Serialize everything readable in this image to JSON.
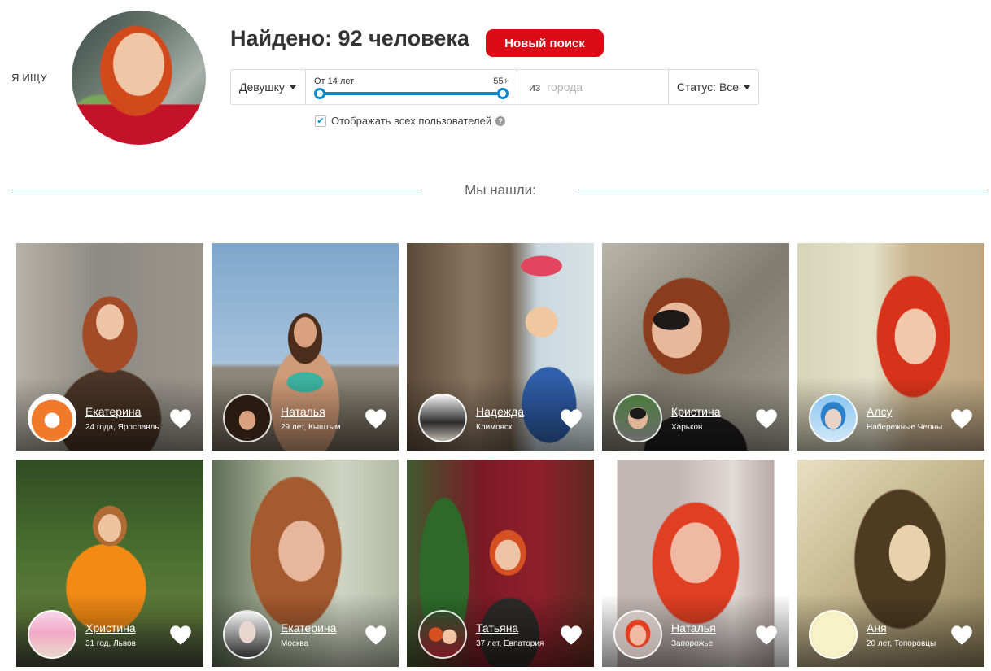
{
  "search": {
    "seek_label": "Я ИЩУ",
    "found_title": "Найдено: 92 человека",
    "new_search_label": "Новый поиск",
    "gender": "Девушку",
    "age_min_label": "От 14 лет",
    "age_max_label": "55+",
    "city_prefix": "из",
    "city_placeholder": "города",
    "status": "Статус: Все",
    "show_all_label": "Отображать всех пользователей",
    "show_all_checked": true,
    "help_glyph": "?"
  },
  "results": {
    "heading": "Мы нашли:",
    "cards": [
      {
        "name": "Екатерина",
        "meta": "24 года, Ярославль"
      },
      {
        "name": "Наталья",
        "meta": "29 лет, Кыштым"
      },
      {
        "name": "Надежда",
        "meta": "Климовск"
      },
      {
        "name": "Кристина",
        "meta": "Харьков"
      },
      {
        "name": "Алсу",
        "meta": "Набережные Челны"
      },
      {
        "name": "Христина",
        "meta": "31 год, Львов"
      },
      {
        "name": "Екатерина",
        "meta": "Москва"
      },
      {
        "name": "Татьяна",
        "meta": "37 лет, Евпатория"
      },
      {
        "name": "Наталья",
        "meta": "Запорожье"
      },
      {
        "name": "Аня",
        "meta": "20 лет, Топоровцы"
      }
    ]
  },
  "icons": {
    "heart": "heart-icon",
    "caret": "caret-down-icon",
    "check": "check-icon",
    "help": "help-icon"
  },
  "colors": {
    "accent": "#0a8bd0",
    "primary_button": "#dc0a14"
  }
}
